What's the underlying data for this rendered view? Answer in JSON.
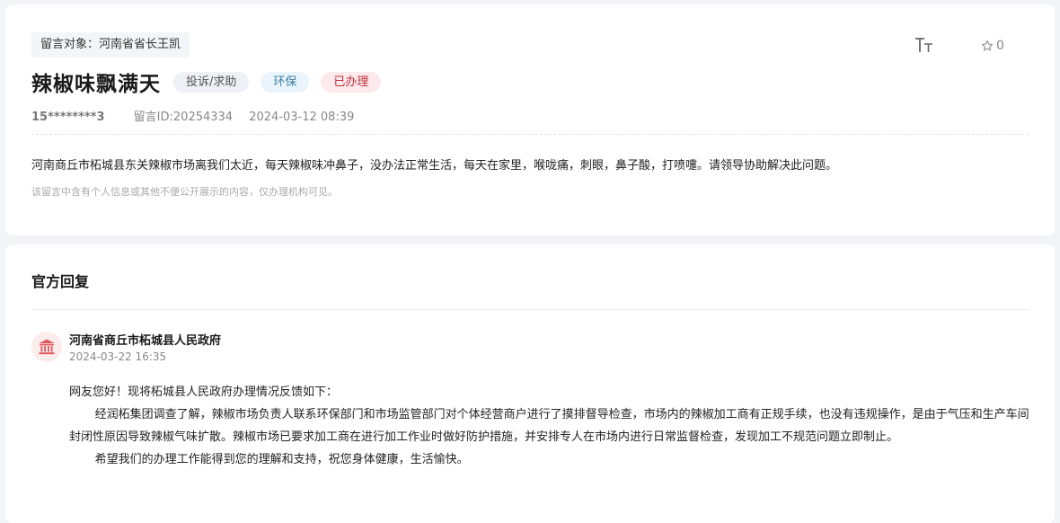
{
  "message": {
    "target": "留言对象：河南省省长王凯",
    "title": "辣椒味飘满天",
    "tags": {
      "type": "投诉/求助",
      "category": "环保",
      "status": "已办理"
    },
    "user": "15********3",
    "message_id": "留言ID:20254334",
    "datetime": "2024-03-12 08:39",
    "star_count": "0",
    "content": "河南商丘市柘城县东关辣椒市场离我们太近，每天辣椒味冲鼻子，没办法正常生活，每天在家里，喉咙痛，刺眼，鼻子酸，打喷嚏。请领导协助解决此问题。",
    "notice": "该留言中含有个人信息或其他不便公开展示的内容，仅办理机构可见。"
  },
  "reply": {
    "heading": "官方回复",
    "org": "河南省商丘市柘城县人民政府",
    "datetime": "2024-03-22 16:35",
    "greeting": "网友您好！现将柘城县人民政府办理情况反馈如下：",
    "paragraph1": "经润柘集团调查了解，辣椒市场负责人联系环保部门和市场监管部门对个体经营商户进行了摸排督导检查，市场内的辣椒加工商有正规手续，也没有违规操作，是由于气压和生产车间封闭性原因导致辣椒气味扩散。辣椒市场已要求加工商在进行加工作业时做好防护措施，并安排专人在市场内进行日常监督检查，发现加工不规范问题立即制止。",
    "paragraph2": "希望我们的办理工作能得到您的理解和支持，祝您身体健康，生活愉快。"
  },
  "icons": {
    "font_size": "font-size-icon",
    "star": "star-icon",
    "org": "government-building-icon"
  },
  "colors": {
    "status_red": "#c0303a",
    "category_blue": "#3b7fa6",
    "org_icon_red": "#e0575b"
  }
}
